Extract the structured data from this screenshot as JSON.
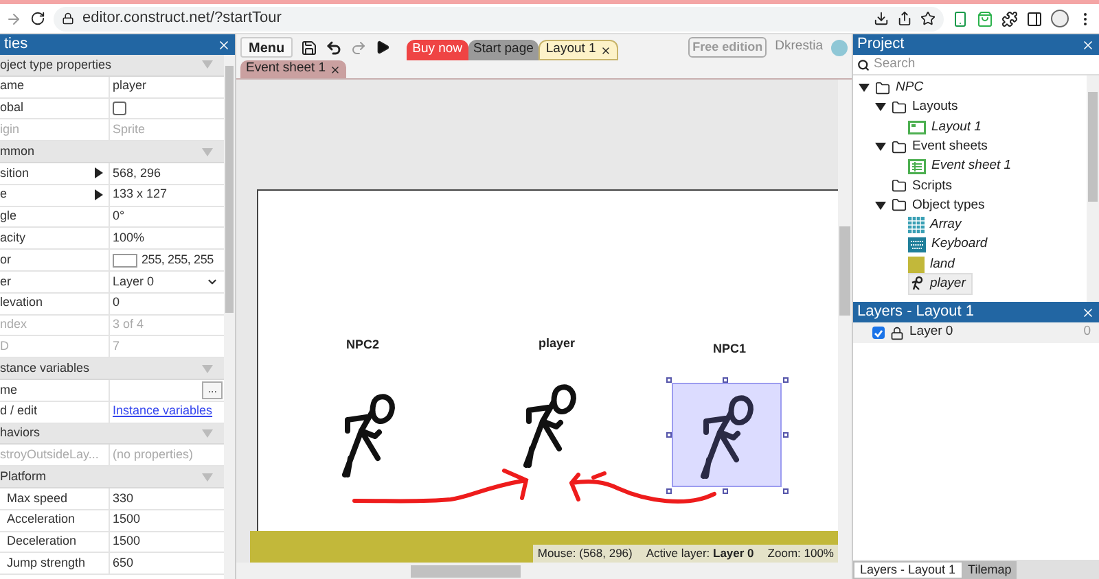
{
  "browser": {
    "url": "editor.construct.net/?startTour"
  },
  "properties": {
    "title": "ties",
    "rows": [
      {
        "kind": "section",
        "label": "oject type properties"
      },
      {
        "kind": "text",
        "label": "ame",
        "value": "player",
        "disabled": false
      },
      {
        "kind": "checkbox",
        "label": "obal",
        "checked": false
      },
      {
        "kind": "text",
        "label": "igin",
        "value": "Sprite",
        "disabled": true
      },
      {
        "kind": "section",
        "label": "mmon"
      },
      {
        "kind": "expand",
        "label": "sition",
        "value": "568, 296"
      },
      {
        "kind": "expand",
        "label": "e",
        "value": "133 x 127"
      },
      {
        "kind": "text",
        "label": "gle",
        "value": "0°",
        "disabled": false
      },
      {
        "kind": "text",
        "label": "acity",
        "value": "100%",
        "disabled": false
      },
      {
        "kind": "color",
        "label": "or",
        "value": "255, 255, 255",
        "color": "#ffffff"
      },
      {
        "kind": "dropdown",
        "label": "er",
        "value": "Layer 0"
      },
      {
        "kind": "text",
        "label": "levation",
        "value": "0",
        "disabled": false
      },
      {
        "kind": "text",
        "label": "ndex",
        "value": "3 of 4",
        "disabled": true
      },
      {
        "kind": "text",
        "label": "D",
        "value": "7",
        "disabled": true
      },
      {
        "kind": "section",
        "label": "stance variables"
      },
      {
        "kind": "button",
        "label": "me",
        "value": "..."
      },
      {
        "kind": "link",
        "label": "d / edit",
        "value": "Instance variables"
      },
      {
        "kind": "section",
        "label": "haviors"
      },
      {
        "kind": "text",
        "label": "stroyOutsideLay...",
        "value": "(no properties)",
        "disabled": true
      },
      {
        "kind": "section",
        "label": "Platform"
      },
      {
        "kind": "text",
        "label": "Max speed",
        "value": "330",
        "disabled": false,
        "indent": true
      },
      {
        "kind": "text",
        "label": "Acceleration",
        "value": "1500",
        "disabled": false,
        "indent": true
      },
      {
        "kind": "text",
        "label": "Deceleration",
        "value": "1500",
        "disabled": false,
        "indent": true
      },
      {
        "kind": "text",
        "label": "Jump strength",
        "value": "650",
        "disabled": false,
        "indent": true
      }
    ]
  },
  "toolbar": {
    "menu": "Menu",
    "tabs": [
      {
        "kind": "buy",
        "label": "Buy now",
        "selected": false
      },
      {
        "kind": "page",
        "label": "Start page",
        "selected": false
      },
      {
        "kind": "layout",
        "label": "Layout 1",
        "selected": true
      }
    ],
    "edition": "Free edition",
    "user": "Dkrestia"
  },
  "subtabs": [
    {
      "label": "Event sheet 1",
      "selected": false
    }
  ],
  "canvas": {
    "labels": [
      {
        "text": "NPC2"
      },
      {
        "text": "player"
      },
      {
        "text": "NPC1"
      }
    ],
    "status": {
      "mouse": "Mouse: (568, 296)",
      "layer": "Active layer: **Layer 0**",
      "zoom": "Zoom: 100%"
    }
  },
  "project": {
    "title": "Project",
    "search": {
      "placeholder": "Search"
    },
    "tree": [
      {
        "label": "NPC",
        "kind": "project",
        "expanded": true,
        "children": [
          {
            "label": "Layouts",
            "kind": "folder",
            "expanded": true,
            "children": [
              {
                "label": "Layout 1",
                "kind": "layout",
                "selected": false
              }
            ]
          },
          {
            "label": "Event sheets",
            "kind": "folder",
            "expanded": true,
            "children": [
              {
                "label": "Event sheet 1",
                "kind": "sheet",
                "selected": false
              }
            ]
          },
          {
            "label": "Scripts",
            "kind": "folder",
            "expanded": false
          },
          {
            "label": "Object types",
            "kind": "folder",
            "expanded": true,
            "children": [
              {
                "label": "Array",
                "kind": "array",
                "selected": false
              },
              {
                "label": "Keyboard",
                "kind": "keyboard",
                "selected": false
              },
              {
                "label": "land",
                "kind": "land",
                "selected": false
              },
              {
                "label": "player",
                "kind": "sprite",
                "selected": true
              }
            ]
          }
        ]
      }
    ]
  },
  "layers": {
    "title": "Layers - Layout 1",
    "rows": [
      {
        "name": "Layer 0",
        "visible": true,
        "count": "0"
      }
    ]
  },
  "bottom_tabs": [
    {
      "label": "Layers - Layout 1",
      "selected": true
    },
    {
      "label": "Tilemap",
      "selected": false
    }
  ]
}
